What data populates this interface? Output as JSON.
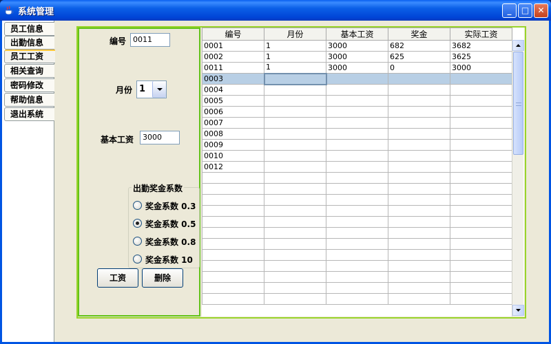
{
  "window": {
    "title": "系统管理",
    "min_glyph": "_",
    "max_glyph": "□",
    "close_glyph": "✕"
  },
  "sidebar": {
    "tabs": [
      {
        "label": "员工信息"
      },
      {
        "label": "出勤信息"
      },
      {
        "label": "员工工资"
      },
      {
        "label": "相关查询"
      },
      {
        "label": "密码修改"
      },
      {
        "label": "帮助信息"
      },
      {
        "label": "退出系统"
      }
    ]
  },
  "form": {
    "id_label": "编号",
    "id_value": "0011",
    "month_label": "月份",
    "month_value": "1",
    "base_label": "基本工资",
    "base_value": "3000",
    "group_title": "出勤奖金系数",
    "radios": [
      {
        "label": "奖金系数 0.3",
        "checked": false
      },
      {
        "label": "奖金系数 0.5",
        "checked": true
      },
      {
        "label": "奖金系数 0.8",
        "checked": false
      },
      {
        "label": "奖金系数 10",
        "checked": false
      }
    ],
    "salary_button": "工资",
    "delete_button": "删除"
  },
  "table": {
    "columns": [
      "编号",
      "月份",
      "基本工资",
      "奖金",
      "实际工资"
    ],
    "rows": [
      [
        "0001",
        "1",
        "3000",
        "682",
        "3682"
      ],
      [
        "0002",
        "1",
        "3000",
        "625",
        "3625"
      ],
      [
        "0011",
        "1",
        "3000",
        "0",
        "3000"
      ],
      [
        "0003",
        "",
        "",
        "",
        ""
      ],
      [
        "0004",
        "",
        "",
        "",
        ""
      ],
      [
        "0005",
        "",
        "",
        "",
        ""
      ],
      [
        "0006",
        "",
        "",
        "",
        ""
      ],
      [
        "0007",
        "",
        "",
        "",
        ""
      ],
      [
        "0008",
        "",
        "",
        "",
        ""
      ],
      [
        "0009",
        "",
        "",
        "",
        ""
      ],
      [
        "0010",
        "",
        "",
        "",
        ""
      ],
      [
        "0012",
        "",
        "",
        "",
        ""
      ],
      [
        "",
        "",
        "",
        "",
        ""
      ],
      [
        "",
        "",
        "",
        "",
        ""
      ],
      [
        "",
        "",
        "",
        "",
        ""
      ],
      [
        "",
        "",
        "",
        "",
        ""
      ],
      [
        "",
        "",
        "",
        "",
        ""
      ],
      [
        "",
        "",
        "",
        "",
        ""
      ],
      [
        "",
        "",
        "",
        "",
        ""
      ],
      [
        "",
        "",
        "",
        "",
        ""
      ],
      [
        "",
        "",
        "",
        "",
        ""
      ],
      [
        "",
        "",
        "",
        "",
        ""
      ],
      [
        "",
        "",
        "",
        "",
        ""
      ],
      [
        "",
        "",
        "",
        "",
        ""
      ]
    ],
    "selected_row": 3
  },
  "icons": {
    "app": "java-coffee-icon",
    "combo_arrow": "chevron-down-icon",
    "scroll_up": "arrow-up-icon",
    "scroll_down": "arrow-down-icon"
  },
  "colors": {
    "titlebar": "#0054e3",
    "panel_border": "#99d42a",
    "selection": "#b8cfe5",
    "tab_highlight": "#ffc83c"
  }
}
